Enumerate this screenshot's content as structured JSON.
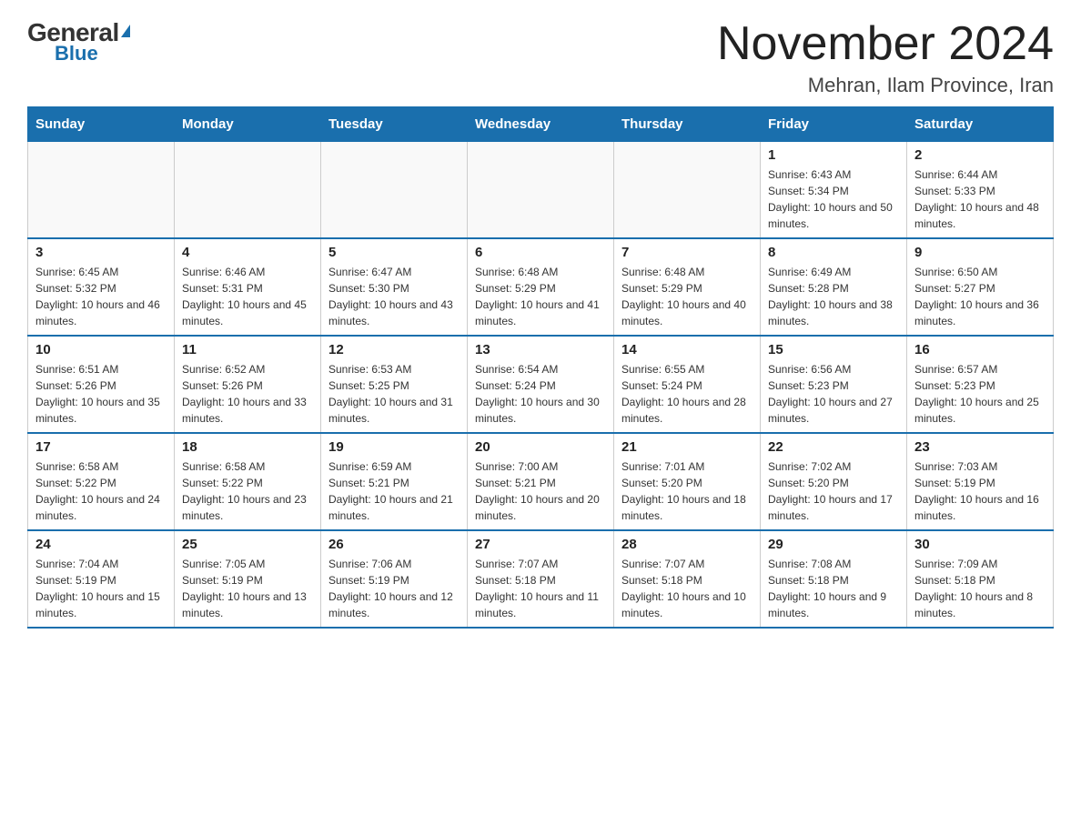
{
  "logo": {
    "general": "General",
    "blue": "Blue",
    "triangle_label": "logo-triangle"
  },
  "title": "November 2024",
  "subtitle": "Mehran, Ilam Province, Iran",
  "days_of_week": [
    "Sunday",
    "Monday",
    "Tuesday",
    "Wednesday",
    "Thursday",
    "Friday",
    "Saturday"
  ],
  "weeks": [
    [
      {
        "day": "",
        "info": ""
      },
      {
        "day": "",
        "info": ""
      },
      {
        "day": "",
        "info": ""
      },
      {
        "day": "",
        "info": ""
      },
      {
        "day": "",
        "info": ""
      },
      {
        "day": "1",
        "info": "Sunrise: 6:43 AM\nSunset: 5:34 PM\nDaylight: 10 hours and 50 minutes."
      },
      {
        "day": "2",
        "info": "Sunrise: 6:44 AM\nSunset: 5:33 PM\nDaylight: 10 hours and 48 minutes."
      }
    ],
    [
      {
        "day": "3",
        "info": "Sunrise: 6:45 AM\nSunset: 5:32 PM\nDaylight: 10 hours and 46 minutes."
      },
      {
        "day": "4",
        "info": "Sunrise: 6:46 AM\nSunset: 5:31 PM\nDaylight: 10 hours and 45 minutes."
      },
      {
        "day": "5",
        "info": "Sunrise: 6:47 AM\nSunset: 5:30 PM\nDaylight: 10 hours and 43 minutes."
      },
      {
        "day": "6",
        "info": "Sunrise: 6:48 AM\nSunset: 5:29 PM\nDaylight: 10 hours and 41 minutes."
      },
      {
        "day": "7",
        "info": "Sunrise: 6:48 AM\nSunset: 5:29 PM\nDaylight: 10 hours and 40 minutes."
      },
      {
        "day": "8",
        "info": "Sunrise: 6:49 AM\nSunset: 5:28 PM\nDaylight: 10 hours and 38 minutes."
      },
      {
        "day": "9",
        "info": "Sunrise: 6:50 AM\nSunset: 5:27 PM\nDaylight: 10 hours and 36 minutes."
      }
    ],
    [
      {
        "day": "10",
        "info": "Sunrise: 6:51 AM\nSunset: 5:26 PM\nDaylight: 10 hours and 35 minutes."
      },
      {
        "day": "11",
        "info": "Sunrise: 6:52 AM\nSunset: 5:26 PM\nDaylight: 10 hours and 33 minutes."
      },
      {
        "day": "12",
        "info": "Sunrise: 6:53 AM\nSunset: 5:25 PM\nDaylight: 10 hours and 31 minutes."
      },
      {
        "day": "13",
        "info": "Sunrise: 6:54 AM\nSunset: 5:24 PM\nDaylight: 10 hours and 30 minutes."
      },
      {
        "day": "14",
        "info": "Sunrise: 6:55 AM\nSunset: 5:24 PM\nDaylight: 10 hours and 28 minutes."
      },
      {
        "day": "15",
        "info": "Sunrise: 6:56 AM\nSunset: 5:23 PM\nDaylight: 10 hours and 27 minutes."
      },
      {
        "day": "16",
        "info": "Sunrise: 6:57 AM\nSunset: 5:23 PM\nDaylight: 10 hours and 25 minutes."
      }
    ],
    [
      {
        "day": "17",
        "info": "Sunrise: 6:58 AM\nSunset: 5:22 PM\nDaylight: 10 hours and 24 minutes."
      },
      {
        "day": "18",
        "info": "Sunrise: 6:58 AM\nSunset: 5:22 PM\nDaylight: 10 hours and 23 minutes."
      },
      {
        "day": "19",
        "info": "Sunrise: 6:59 AM\nSunset: 5:21 PM\nDaylight: 10 hours and 21 minutes."
      },
      {
        "day": "20",
        "info": "Sunrise: 7:00 AM\nSunset: 5:21 PM\nDaylight: 10 hours and 20 minutes."
      },
      {
        "day": "21",
        "info": "Sunrise: 7:01 AM\nSunset: 5:20 PM\nDaylight: 10 hours and 18 minutes."
      },
      {
        "day": "22",
        "info": "Sunrise: 7:02 AM\nSunset: 5:20 PM\nDaylight: 10 hours and 17 minutes."
      },
      {
        "day": "23",
        "info": "Sunrise: 7:03 AM\nSunset: 5:19 PM\nDaylight: 10 hours and 16 minutes."
      }
    ],
    [
      {
        "day": "24",
        "info": "Sunrise: 7:04 AM\nSunset: 5:19 PM\nDaylight: 10 hours and 15 minutes."
      },
      {
        "day": "25",
        "info": "Sunrise: 7:05 AM\nSunset: 5:19 PM\nDaylight: 10 hours and 13 minutes."
      },
      {
        "day": "26",
        "info": "Sunrise: 7:06 AM\nSunset: 5:19 PM\nDaylight: 10 hours and 12 minutes."
      },
      {
        "day": "27",
        "info": "Sunrise: 7:07 AM\nSunset: 5:18 PM\nDaylight: 10 hours and 11 minutes."
      },
      {
        "day": "28",
        "info": "Sunrise: 7:07 AM\nSunset: 5:18 PM\nDaylight: 10 hours and 10 minutes."
      },
      {
        "day": "29",
        "info": "Sunrise: 7:08 AM\nSunset: 5:18 PM\nDaylight: 10 hours and 9 minutes."
      },
      {
        "day": "30",
        "info": "Sunrise: 7:09 AM\nSunset: 5:18 PM\nDaylight: 10 hours and 8 minutes."
      }
    ]
  ]
}
